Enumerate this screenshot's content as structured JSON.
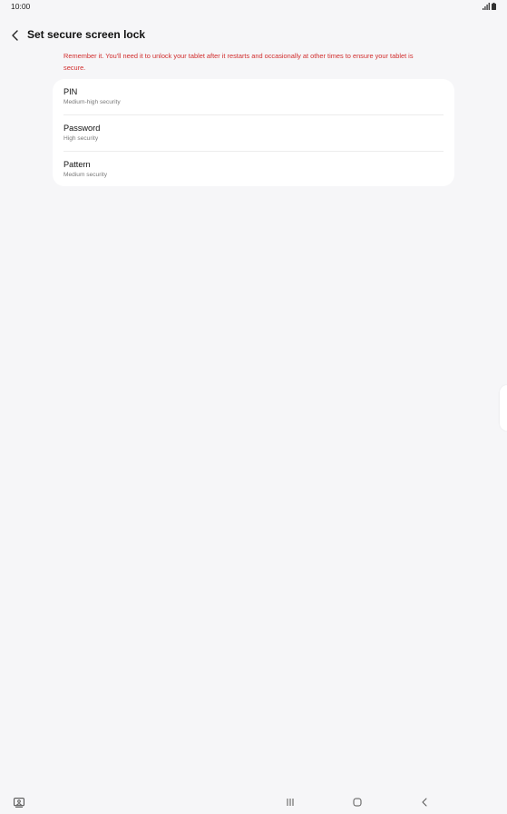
{
  "status_bar": {
    "time": "10:00",
    "icons": [
      "signal-icon",
      "battery-icon"
    ]
  },
  "header": {
    "title": "Set secure screen lock",
    "back_icon": "chevron-left-icon"
  },
  "warning_text": "Remember it. You'll need it to unlock your tablet after it restarts and occasionally at other times to ensure your tablet is secure.",
  "options": [
    {
      "title": "PIN",
      "subtitle": "Medium-high security"
    },
    {
      "title": "Password",
      "subtitle": "High security"
    },
    {
      "title": "Pattern",
      "subtitle": "Medium security"
    }
  ],
  "nav_bar": {
    "icons": [
      "keyboard-icon",
      "recents-icon",
      "home-icon",
      "back-icon"
    ]
  },
  "colors": {
    "background": "#f6f6f8",
    "card": "#ffffff",
    "warning": "#d12d2d",
    "text": "#111111",
    "subtext": "#7a7a7a"
  }
}
